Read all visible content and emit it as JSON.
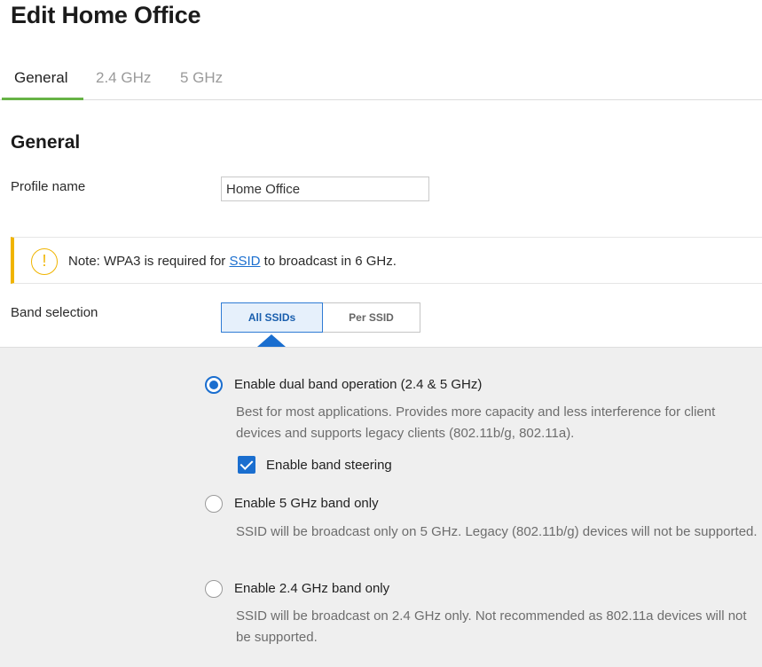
{
  "page": {
    "title": "Edit Home Office"
  },
  "tabs": [
    {
      "label": "General",
      "active": true
    },
    {
      "label": "2.4 GHz",
      "active": false
    },
    {
      "label": "5 GHz",
      "active": false
    }
  ],
  "general": {
    "section_title": "General",
    "profile_name_label": "Profile name",
    "profile_name_value": "Home Office"
  },
  "note": {
    "icon": "warning-circle-icon",
    "prefix": "Note: WPA3 is required for ",
    "link": "SSID",
    "suffix": " to broadcast in 6 GHz.",
    "color": "#f0b400"
  },
  "band": {
    "label": "Band selection",
    "segments": [
      {
        "label": "All SSIDs",
        "active": true
      },
      {
        "label": "Per SSID",
        "active": false
      }
    ],
    "options": [
      {
        "label": "Enable dual band operation (2.4 & 5 GHz)",
        "selected": true,
        "description": "Best for most applications. Provides more capacity and less interference for client devices and supports legacy clients (802.11b/g, 802.11a)."
      },
      {
        "label": "Enable 5 GHz band only",
        "selected": false,
        "description": "SSID will be broadcast only on 5 GHz. Legacy (802.11b/g) devices will not be supported."
      },
      {
        "label": "Enable 2.4 GHz band only",
        "selected": false,
        "description": "SSID will be broadcast on 2.4 GHz only. Not recommended as 802.11a devices will not be supported."
      }
    ],
    "band_steering": {
      "label": "Enable band steering",
      "checked": true
    }
  },
  "colors": {
    "accent": "#1a6ecf",
    "tab_underline": "#67b346",
    "warning": "#f0b400",
    "panel_bg": "#efefef"
  }
}
